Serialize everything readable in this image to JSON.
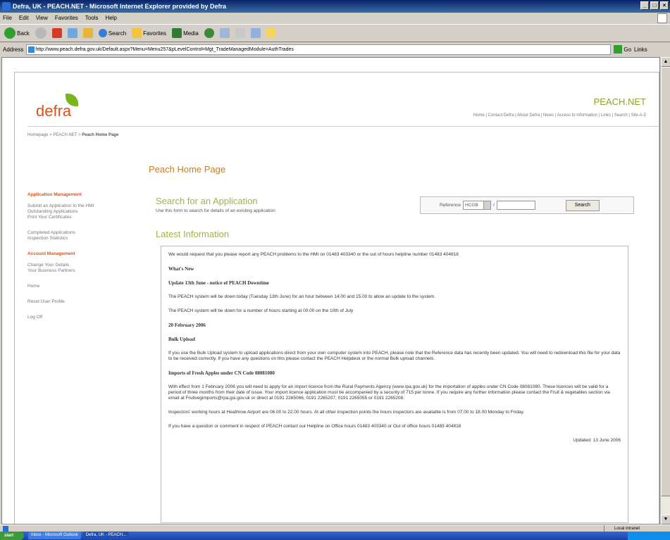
{
  "window": {
    "title": "Defra, UK - PEACH.NET - Microsoft Internet Explorer provided by Defra"
  },
  "menu": [
    "File",
    "Edit",
    "View",
    "Favorites",
    "Tools",
    "Help"
  ],
  "toolbar": {
    "back": "Back",
    "search": "Search",
    "favorites": "Favorites",
    "media": "Media"
  },
  "address": {
    "label": "Address",
    "url": "http://www.peach.defra.gov.uk/Default.aspx?Menu=Menu257&pLevelControl=Mgt_TradeManagedModule=AuthTrades",
    "go": "Go",
    "links": "Links"
  },
  "header": {
    "logo": "defra",
    "site_name": "PEACH.NET",
    "top_links": "Home | Contact Defra | About Defra | News | Access to information | Links | Search | Site A-Z"
  },
  "breadcrumb": {
    "home": "Homepage",
    "mid": "PEACH.NET",
    "current": "Peach Home Page"
  },
  "page_title": "Peach Home Page",
  "sidebar": {
    "application_heading": "Application Management",
    "application_links": [
      "Submit an Application to the HMI",
      "Outstanding Applications",
      "Print Your Certificates"
    ],
    "completed_links": [
      "Completed Applications",
      "Inspection Statistics"
    ],
    "account_heading": "Account Management",
    "account_links": [
      "Change Your Details",
      "Your Business Partners"
    ],
    "home": "Home",
    "reset": "Reset User Profile",
    "logoff": "Log Off"
  },
  "search": {
    "title": "Search for an Application",
    "subtitle": "Use this form to search for details of an existing application",
    "reference_label": "Reference",
    "reference_value": "HCGB",
    "separator": "/",
    "button": "Search"
  },
  "latest": {
    "title": "Latest Information",
    "p1": "We would request that you please report any PEACH problems to the HMI on 01483 403340 or the out of hours helpline number 01483 404818",
    "whats_new": "What's New",
    "update_heading": "Update 13th June - notice of PEACH Downtime",
    "p2": "The PEACH system will be down today (Tuesday 13th June) for an hour between 14.00 and 15.00 to allow an update to the system.",
    "p3": "The PEACH system will be down for a number of hours starting at 00.00 on the 10th of July",
    "date_heading": "20 February 2006",
    "bulk_heading": "Bulk Upload",
    "p4": "If you use the Bulk Upload system to upload applications direct from your own computer system into PEACH, please note that the Reference data has recently been updated. You will need to redownload this file for your data to be received correctly. If you have any questions on this please contact the PEACH Helpdesk or the normal Bulk upload channels.",
    "apples_heading": "Imports of Fresh Apples under CN Code 08081080",
    "p5": "With effect from 1 February 2006 you will need to apply for an import licence from the Rural Payments Agency (www.rpa.gov.uk) for the importation of apples under CN Code 08081080. These licences will be valid for a period of three months from their date of issue. Your import licence application must be accompanied by a security of 715 per tonne. If you require any further information please contact the Fruit & vegetables section via email at Fruitvegimports@rpa.gsi.gov.uk or direct at 0191 2265066, 0191 2265207, 0191 2265055 or 0191 2265208.",
    "p6": "Inspectors' working hours at Heathrow Airport are 06.00 to 22.00 hours. At all other inspection points the hours inspectors are available is from 07.00 to 18.00 Monday to Friday.",
    "p7": "If you have a question or comment in respect of PEACH contact our Helpline on Office hours 01483 403340 or Out of office hours 01483 404818",
    "updated": "Updated: 13 June 2006"
  },
  "status": {
    "zone": "Local intranet"
  },
  "taskbar": {
    "start": "start",
    "tasks": [
      "Inbox - Microsoft Outlook",
      "Defra, UK - PEACH..."
    ]
  }
}
